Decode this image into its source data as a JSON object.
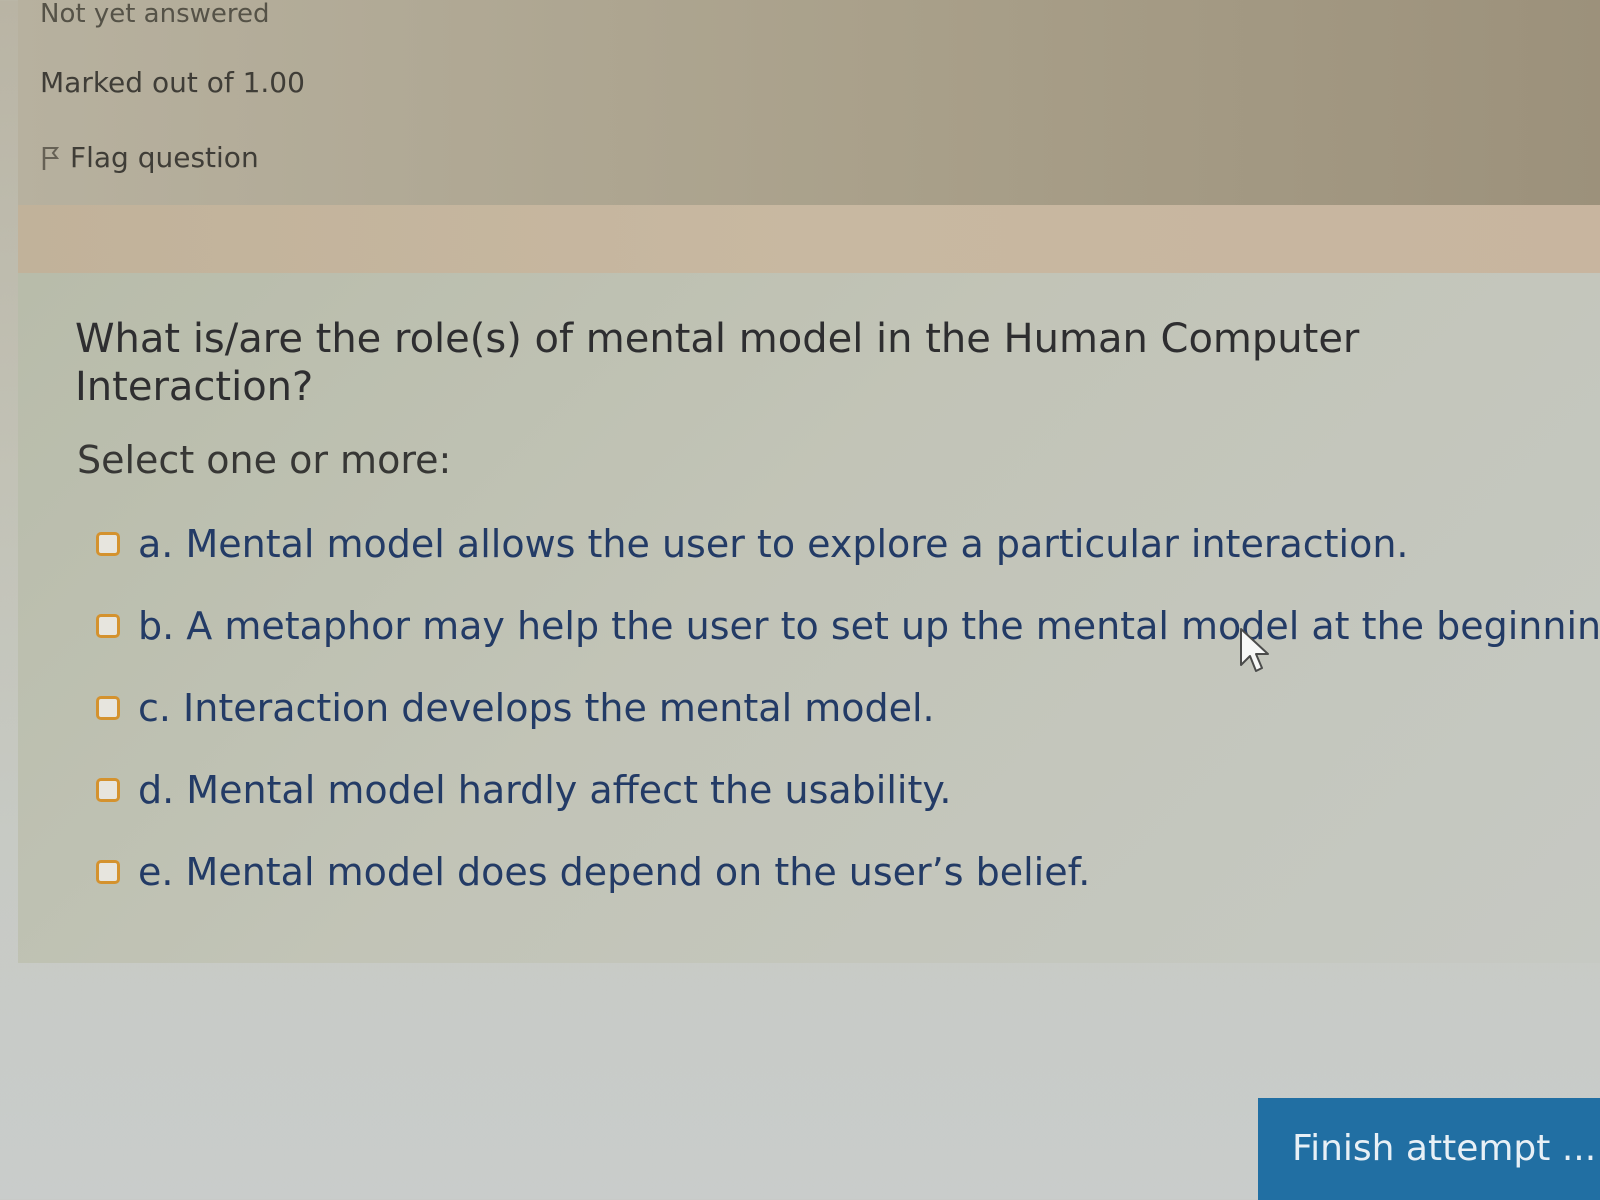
{
  "info": {
    "status": "Not yet answered",
    "marks": "Marked out of 1.00",
    "flag_label": "Flag question",
    "flag_icon": "flag-icon"
  },
  "question": {
    "text": "What is/are the role(s) of mental model in the Human Computer Interaction?",
    "prompt": "Select one or more:",
    "options": [
      {
        "label": "a. Mental model allows the user to explore a particular interaction.",
        "checked": false
      },
      {
        "label": "b. A metaphor may help the user to set up the mental model at the beginning.",
        "checked": false
      },
      {
        "label": "c. Interaction develops the mental model.",
        "checked": false
      },
      {
        "label": "d. Mental model hardly affect the usability.",
        "checked": false
      },
      {
        "label": "e. Mental model does depend on the user’s belief.",
        "checked": false
      }
    ]
  },
  "actions": {
    "finish_label": "Finish attempt ..."
  },
  "colors": {
    "option_text": "#233b66",
    "checkbox_border": "#d4922e",
    "finish_button": "#216fa3"
  },
  "icons": {
    "cursor": "mouse-pointer-icon"
  }
}
